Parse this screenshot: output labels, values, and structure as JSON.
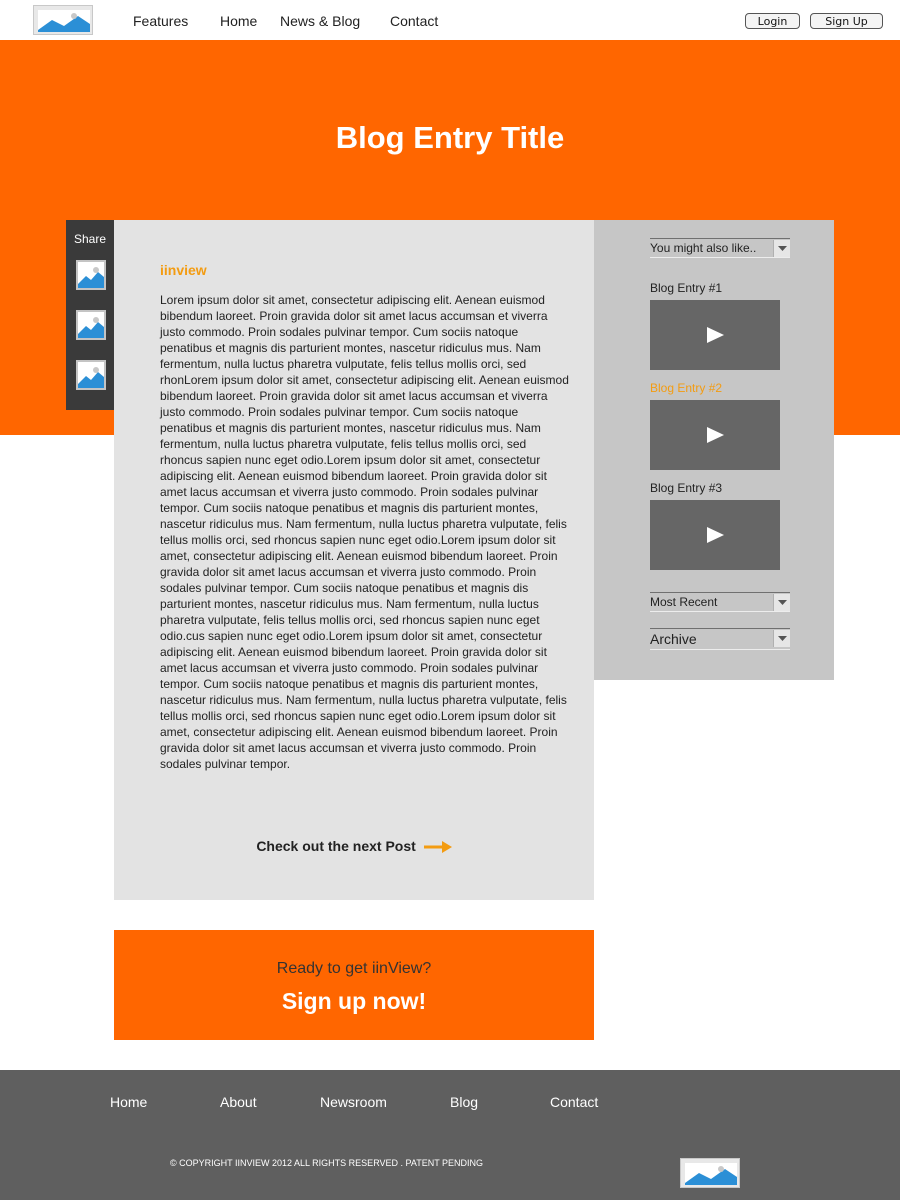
{
  "header": {
    "nav": [
      "Features",
      "Home",
      "News & Blog",
      "Contact"
    ],
    "login_label": "Login",
    "signup_label": "Sign Up"
  },
  "hero": {
    "title": "Blog Entry Title"
  },
  "share": {
    "label": "Share"
  },
  "article": {
    "heading": "iinview",
    "body": "Lorem ipsum dolor sit amet, consectetur adipiscing elit. Aenean euismod bibendum laoreet. Proin gravida dolor sit amet lacus accumsan et viverra justo commodo. Proin sodales pulvinar tempor. Cum sociis natoque penatibus et magnis dis parturient montes, nascetur ridiculus mus. Nam fermentum, nulla luctus pharetra vulputate, felis tellus mollis orci, sed rhonLorem ipsum dolor sit amet, consectetur adipiscing elit. Aenean euismod bibendum laoreet. Proin gravida dolor sit amet lacus accumsan et viverra justo commodo. Proin sodales pulvinar tempor. Cum sociis natoque penatibus et magnis dis parturient montes, nascetur ridiculus mus. Nam fermentum, nulla luctus pharetra vulputate, felis tellus mollis orci, sed rhoncus sapien nunc eget odio.Lorem ipsum dolor sit amet, consectetur adipiscing elit. Aenean euismod bibendum laoreet. Proin gravida dolor sit amet lacus accumsan et viverra justo commodo. Proin sodales pulvinar tempor. Cum sociis natoque penatibus et magnis dis parturient montes, nascetur ridiculus mus. Nam fermentum, nulla luctus pharetra vulputate, felis tellus mollis orci, sed rhoncus sapien nunc eget odio.Lorem ipsum dolor sit amet, consectetur adipiscing elit. Aenean euismod bibendum laoreet. Proin gravida dolor sit amet lacus accumsan et viverra justo commodo. Proin sodales pulvinar tempor. Cum sociis natoque penatibus et magnis dis parturient montes, nascetur ridiculus mus. Nam fermentum, nulla luctus pharetra vulputate, felis tellus mollis orci, sed rhoncus sapien nunc eget odio.cus sapien nunc eget odio.Lorem ipsum dolor sit amet, consectetur adipiscing elit. Aenean euismod bibendum laoreet. Proin gravida dolor sit amet lacus accumsan et viverra justo commodo. Proin sodales pulvinar tempor. Cum sociis natoque penatibus et magnis dis parturient montes, nascetur ridiculus mus. Nam fermentum, nulla luctus pharetra vulputate, felis tellus mollis orci, sed rhoncus sapien nunc eget odio.Lorem ipsum dolor sit amet, consectetur adipiscing elit. Aenean euismod bibendum laoreet. Proin gravida dolor sit amet lacus accumsan et viverra justo commodo. Proin sodales pulvinar tempor.",
    "next_post": "Check out the next Post"
  },
  "sidebar": {
    "also_like": "You might also like..",
    "entries": [
      {
        "title": "Blog Entry #1",
        "highlighted": false
      },
      {
        "title": "Blog Entry #2",
        "highlighted": true
      },
      {
        "title": "Blog Entry #3",
        "highlighted": false
      }
    ],
    "most_recent": "Most Recent",
    "archive": "Archive"
  },
  "cta": {
    "subtitle": "Ready to get iinView?",
    "title": "Sign up now!"
  },
  "footer": {
    "links": [
      "Home",
      "About",
      "Newsroom",
      "Blog",
      "Contact"
    ],
    "copyright": "© COPYRIGHT IINVIEW 2012 ALL RIGHTS RESERVED . PATENT PENDING"
  },
  "colors": {
    "brand_orange": "#ff6600",
    "accent_orange": "#f39c12",
    "footer_gray": "#5f5f5f"
  }
}
